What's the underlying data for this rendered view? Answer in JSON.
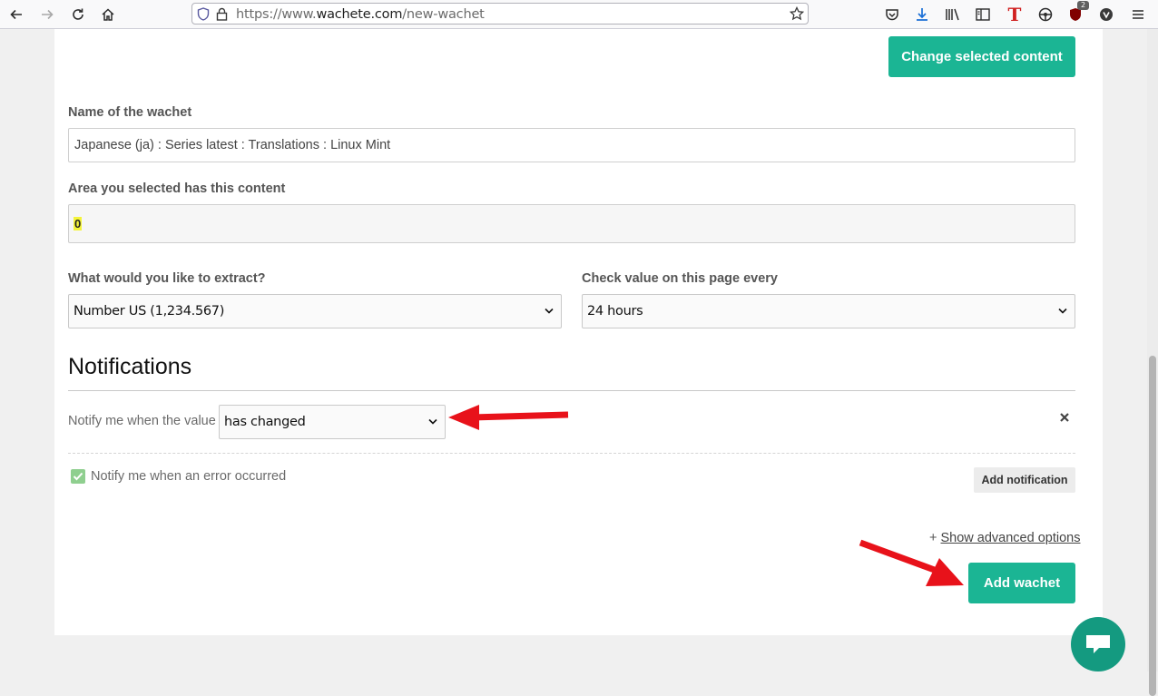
{
  "browser": {
    "url_prefix": "https://www.",
    "url_domain": "wachete.com",
    "url_path": "/new-wachet",
    "extension_badge": "2"
  },
  "form": {
    "change_content_button": "Change selected content",
    "name_label": "Name of the wachet",
    "name_value": "Japanese (ja) : Series latest : Translations : Linux Mint",
    "area_label": "Area you selected has this content",
    "area_value": "0",
    "extract_label": "What would you like to extract?",
    "extract_value": "Number US (1,234.567)",
    "check_label": "Check value on this page every",
    "check_value": "24 hours"
  },
  "notifications": {
    "heading": "Notifications",
    "notify_label": "Notify me when the value",
    "notify_value": "has changed",
    "error_label": "Notify me when an error occurred",
    "error_checked": true,
    "add_notification_button": "Add notification"
  },
  "footer": {
    "advanced_prefix": "+",
    "advanced_link": "Show advanced options",
    "add_wachet_button": "Add wachet"
  },
  "colors": {
    "accent": "#1bb594",
    "annotation_arrow": "#e8121a",
    "highlight": "#f4f43a"
  },
  "icons": [
    "back-icon",
    "forward-icon",
    "reload-icon",
    "home-icon",
    "shield-icon",
    "lock-icon",
    "star-icon",
    "pocket-icon",
    "download-icon",
    "library-icon",
    "sidebar-icon",
    "t-extension-icon",
    "extension-icon",
    "ublock-icon",
    "extension2-icon",
    "menu-icon",
    "close-icon",
    "check-icon",
    "chat-icon"
  ]
}
